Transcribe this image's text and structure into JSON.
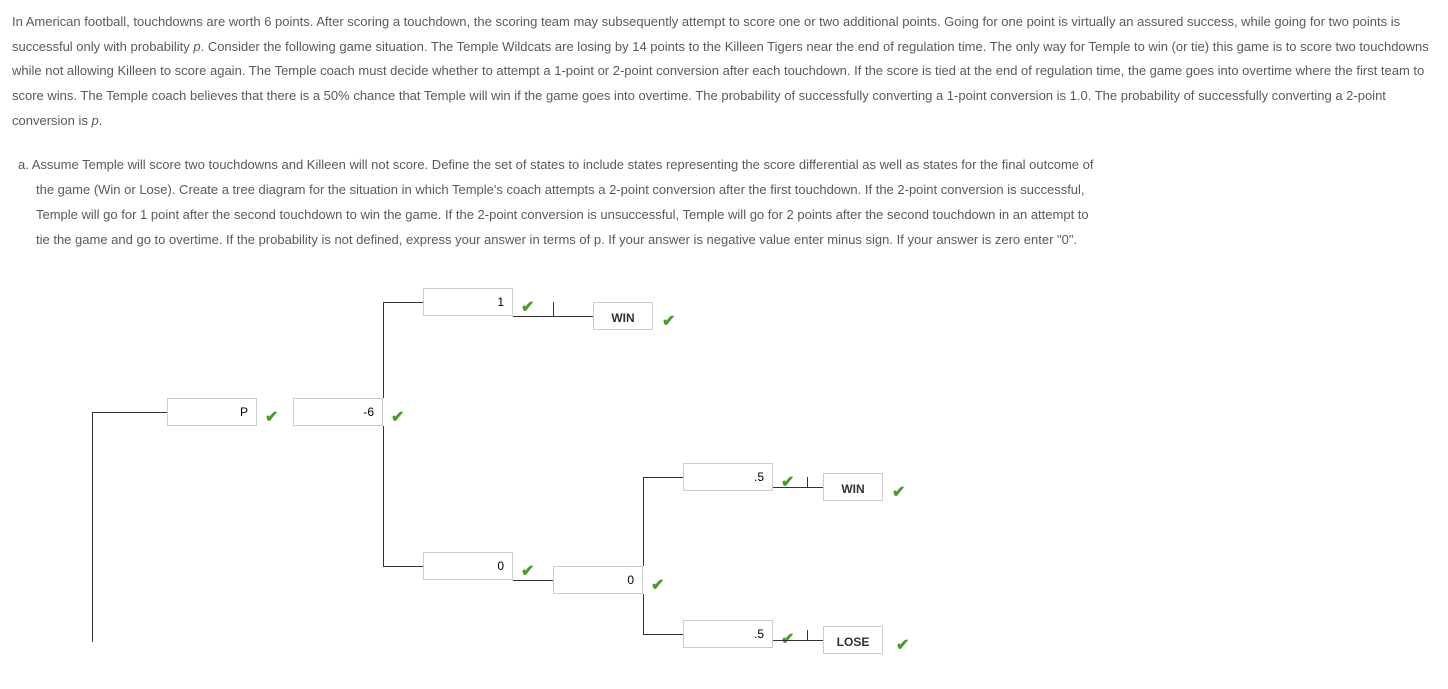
{
  "problem_text": {
    "para1": "In American football, touchdowns are worth 6 points. After scoring a touchdown, the scoring team may subsequently attempt to score one or two additional points. Going for one point is virtually an assured success, while going for two points is successful only with probability ",
    "p1": "p",
    "para2": ". Consider the following game situation. The Temple Wildcats are losing by 14 points to the Killeen Tigers near the end of regulation time. The only way for Temple to win (or tie) this game is to score two touchdowns while not allowing Killeen to score again. The Temple coach must decide whether to attempt a 1-point or 2-point conversion after each touchdown. If the score is tied at the end of regulation time, the game goes into overtime where the first team to score wins. The Temple coach believes that there is a 50% chance that Temple will win if the game goes into overtime. The probability of successfully converting a 1-point conversion is 1.0. The probability of successfully converting a 2-point conversion is ",
    "p2": "p",
    "para3": "."
  },
  "part_a": {
    "marker": "a. ",
    "line1": "Assume Temple will score two touchdowns and Killeen will not score. Define the set of states to include states representing the score differential as well as states for the final outcome of",
    "line2": "the game (Win or Lose). Create a tree diagram for the situation in which Temple's coach attempts a 2-point conversion after the first touchdown. If the 2-point conversion is successful,",
    "line3": "Temple will go for 1 point after the second touchdown to win the game. If the 2-point conversion is unsuccessful, Temple will go for 2 points after the second touchdown in an attempt to",
    "line4": "tie the game and go to overtime. If the probability is not defined, express your answer in terms of p. If your answer is negative value enter minus sign. If your answer is zero enter \"0\"."
  },
  "tree": {
    "inputs": {
      "input_p": "P",
      "input_neg6": "-6",
      "input_1": "1",
      "input_0a": "0",
      "input_0b": "0",
      "input_p5a": ".5",
      "input_p5b": ".5"
    },
    "outcomes": {
      "win1": "WIN",
      "win2": "WIN",
      "lose": "LOSE"
    },
    "check": "✔"
  }
}
